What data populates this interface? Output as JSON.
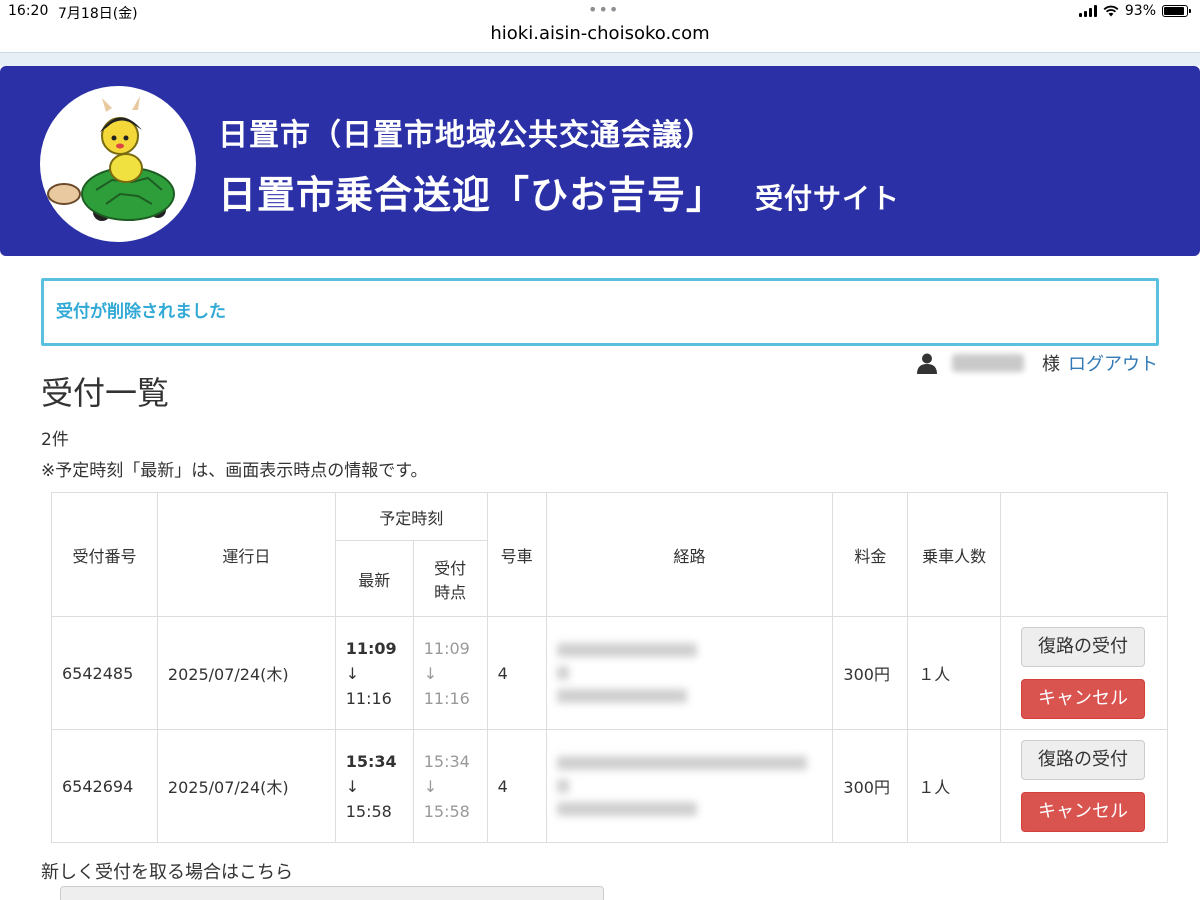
{
  "status_bar": {
    "time": "16:20",
    "date": "7月18日(金)",
    "battery": "93%"
  },
  "browser": {
    "url": "hioki.aisin-choisoko.com"
  },
  "header": {
    "subtitle": "日置市（日置市地域公共交通会議）",
    "title": "日置市乗合送迎「ひお吉号」",
    "tag": "受付サイト"
  },
  "alert": {
    "message": "受付が削除されました"
  },
  "user": {
    "honorific": "様",
    "logout_label": "ログアウト"
  },
  "page": {
    "title": "受付一覧",
    "count": "2件",
    "note": "※予定時刻「最新」は、画面表示時点の情報です。"
  },
  "table": {
    "headers": {
      "number": "受付番号",
      "date": "運行日",
      "scheduled": "予定時刻",
      "latest": "最新",
      "at_booking_1": "受付",
      "at_booking_2": "時点",
      "vehicle": "号車",
      "route": "経路",
      "fare": "料金",
      "passengers": "乗車人数"
    },
    "rows": [
      {
        "number": "6542485",
        "date": "2025/07/24(木)",
        "latest_dep": "11:09",
        "latest_arr": "11:16",
        "booked_dep": "11:09",
        "booked_arr": "11:16",
        "arrow": "↓",
        "vehicle": "4",
        "fare": "300円",
        "passengers": "１人",
        "return_label": "復路の受付",
        "cancel_label": "キャンセル"
      },
      {
        "number": "6542694",
        "date": "2025/07/24(木)",
        "latest_dep": "15:34",
        "latest_arr": "15:58",
        "booked_dep": "15:34",
        "booked_arr": "15:58",
        "arrow": "↓",
        "vehicle": "4",
        "fare": "300円",
        "passengers": "１人",
        "return_label": "復路の受付",
        "cancel_label": "キャンセル"
      }
    ]
  },
  "footer": {
    "new_booking_text": "新しく受付を取る場合はこちら"
  },
  "colors": {
    "banner": "#2b30a6",
    "alert_border": "#5bc0de",
    "alert_text": "#31a9d6",
    "link": "#337ab7",
    "danger": "#d9534f"
  }
}
